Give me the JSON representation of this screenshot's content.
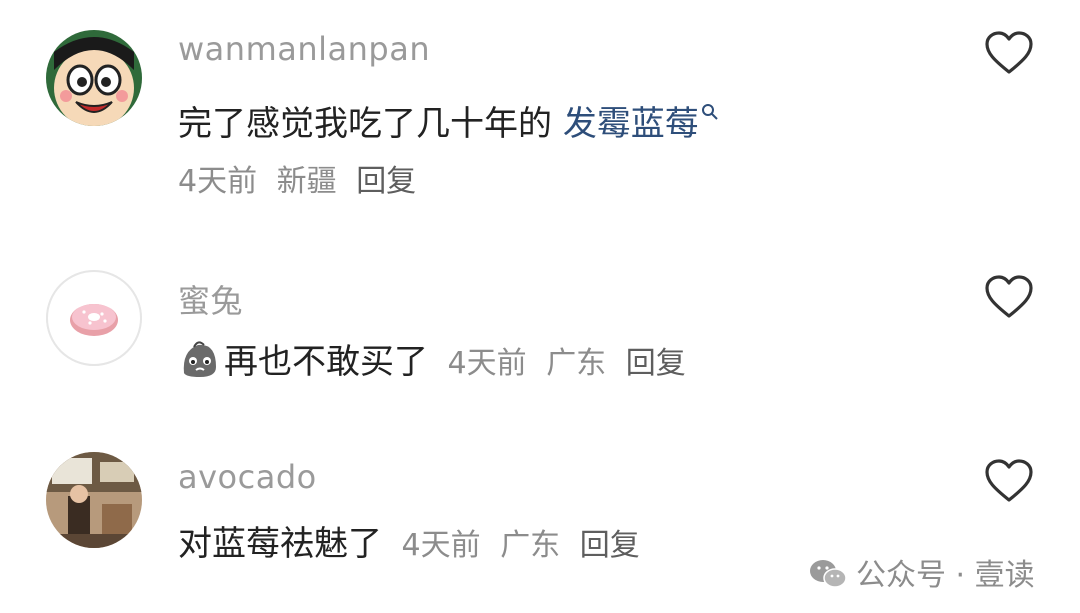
{
  "comments": [
    {
      "username": "wanmanlanpan",
      "text": "完了感觉我吃了几十年的",
      "link_text": "发霉蓝莓",
      "time": "4天前",
      "location": "新疆",
      "reply_label": "回复",
      "avatar_icon": "cartoon-face-avatar"
    },
    {
      "username": "蜜兔",
      "emoji": "sad-face-emoji",
      "text": "再也不敢买了",
      "time": "4天前",
      "location": "广东",
      "reply_label": "回复",
      "avatar_icon": "donut-avatar"
    },
    {
      "username": "avocado",
      "text": "对蓝莓祛魅了",
      "time": "4天前",
      "location": "广东",
      "reply_label": "回复",
      "avatar_icon": "photo-avatar"
    }
  ],
  "watermark": {
    "text": "公众号 · 壹读",
    "icon": "wechat-icon"
  },
  "colors": {
    "link": "#2e4e7a",
    "meta": "#8c8c8c",
    "username": "#9a9a9a"
  }
}
